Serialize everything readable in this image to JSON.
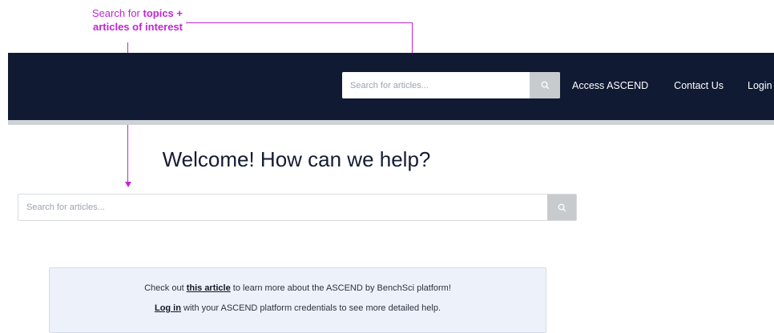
{
  "annotation": {
    "prefix": "Search for ",
    "bold_line1": "topics +",
    "bold_line2": "articles of interest",
    "color": "#c026d3"
  },
  "nav": {
    "background": "#111a33",
    "search_placeholder": "Search for articles...",
    "search_icon": "search-icon",
    "links": [
      "Access ASCEND",
      "Contact Us",
      "Login"
    ]
  },
  "main": {
    "title": "Welcome! How can we help?",
    "search_placeholder": "Search for articles...",
    "search_icon": "search-icon"
  },
  "info": {
    "line1_before": "Check out ",
    "line1_link": "this article",
    "line1_after": " to learn more about the ASCEND by BenchSci platform!",
    "line2_link": "Log in",
    "line2_after": " with your ASCEND platform credentials to see more detailed help."
  }
}
